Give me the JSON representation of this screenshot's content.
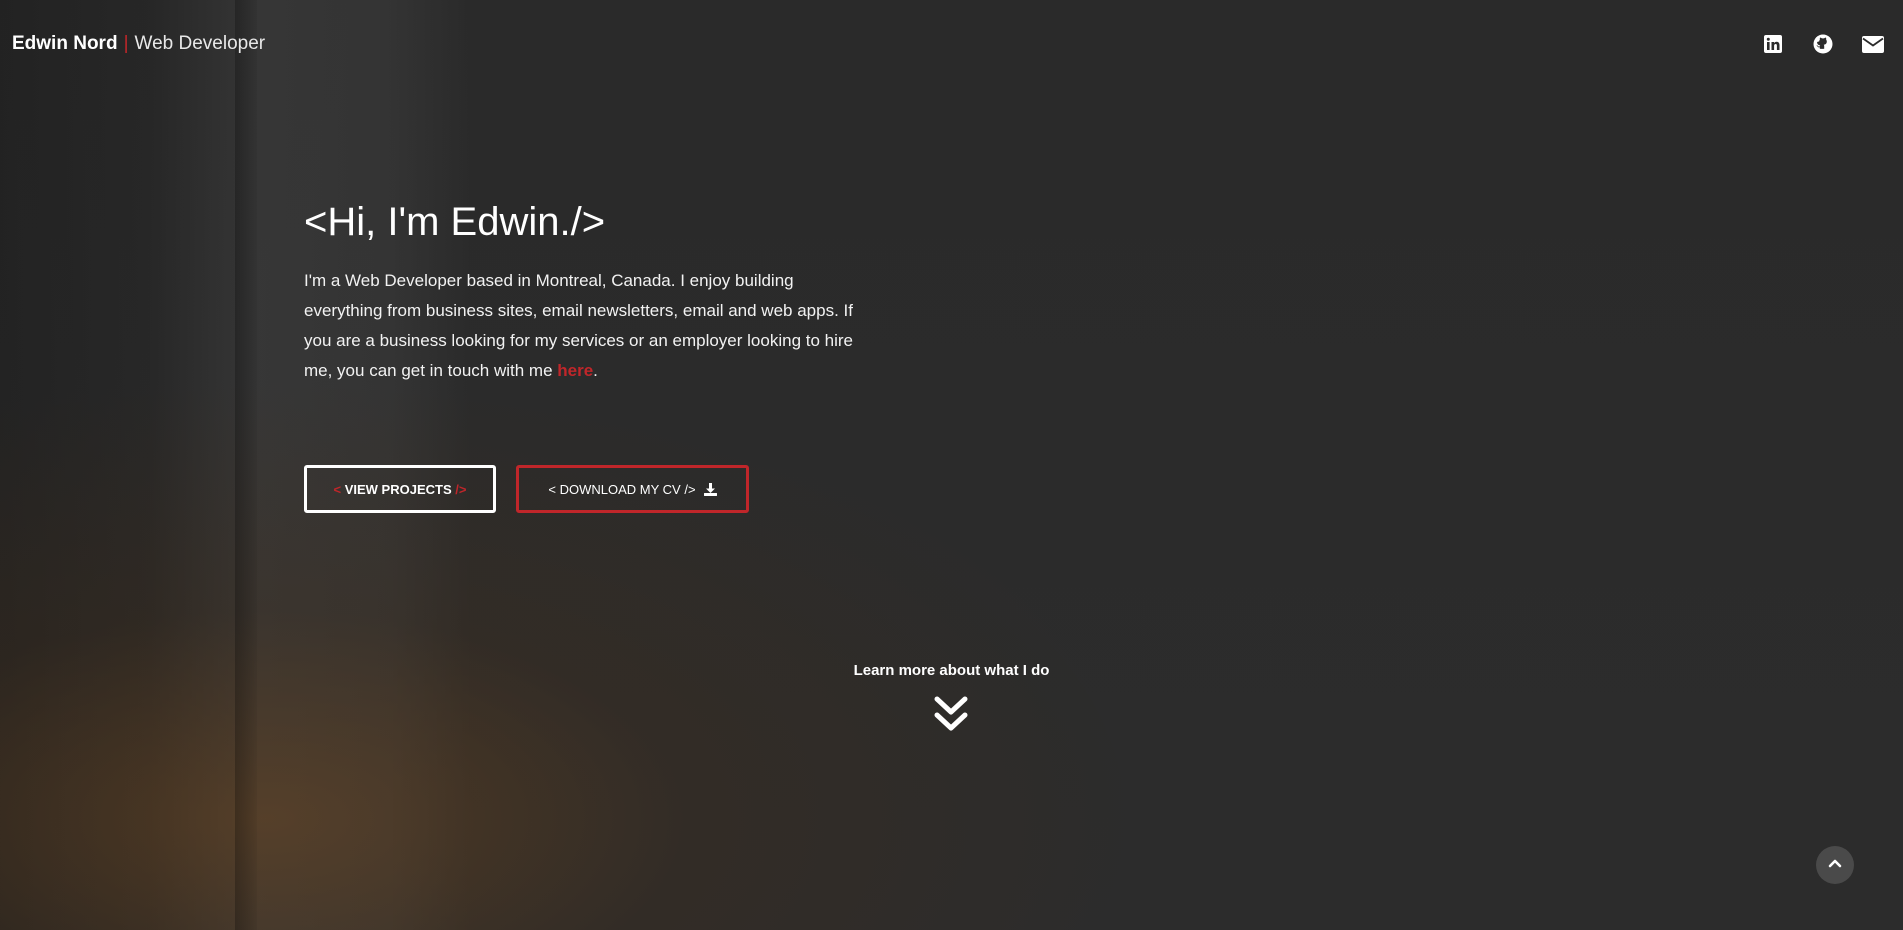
{
  "header": {
    "name": "Edwin Nord",
    "separator": "|",
    "role": "Web Developer",
    "social_icons": [
      "linkedin-icon",
      "github-icon",
      "envelope-icon"
    ]
  },
  "hero": {
    "title": "<Hi, I'm Edwin./>",
    "intro_text": "I'm a Web Developer based in Montreal, Canada. I enjoy building everything from business sites, email newsletters, email and web apps. If you are a business looking for my services or an employer looking to hire me, you can get in touch with me ",
    "link_text": "here",
    "end_text": "."
  },
  "buttons": {
    "projects": {
      "open": "<",
      "label": "VIEW PROJECTS",
      "close": "/>"
    },
    "cv": {
      "label": "< DOWNLOAD MY CV />",
      "icon": "download-icon"
    }
  },
  "learn_more": "Learn more about what I do",
  "colors": {
    "accent": "#c0262a",
    "background": "#2b2b2b",
    "text": "#ffffff"
  },
  "icons": {
    "scroll_down": "double-chevron-down-icon",
    "scroll_top": "chevron-up-icon"
  }
}
